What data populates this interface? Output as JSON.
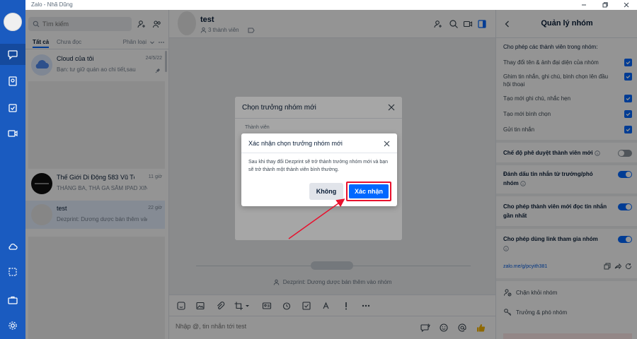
{
  "app": {
    "title": "Zalo - Nhã Dũng"
  },
  "colors": {
    "nav_bg": "#1a5bc0",
    "primary": "#0068ff",
    "highlight": "#e8112d"
  },
  "conversation_list": {
    "search_placeholder": "Tìm kiếm",
    "tabs": [
      "Tất cả",
      "Chưa đọc"
    ],
    "filter_label": "Phân loại",
    "items": [
      {
        "name": "Cloud của tôi",
        "message": "Bạn: tư giữ quán ao chi tiết,sau",
        "time": "24/5/22"
      },
      {
        "name": "Thế Giới Di Động 583 Vũ Tô...",
        "message": "THÁNG BA, THÁ GA SẮM IPAD XIN...",
        "time": "11 giờ"
      },
      {
        "name": "test",
        "message": "Dezprint: Dương dược bán thêm vào...",
        "time": "22 giờ"
      }
    ]
  },
  "chat": {
    "name": "test",
    "members": "3 thành viên",
    "system_message": "Dezprint: Dương dược bán thêm vào nhóm",
    "composer_placeholder": "Nhập @, tin nhắn tới test"
  },
  "right_panel": {
    "title": "Quản lý nhóm",
    "permissions_title": "Cho phép các thành viên trong nhóm:",
    "permissions": [
      "Thay đổi tên & ảnh đại diện của nhóm",
      "Ghim tin nhắn, ghi chú, bình chọn lên đầu hội thoại",
      "Tạo mới ghi chú, nhắc hẹn",
      "Tạo mới bình chọn",
      "Gửi tin nhắn"
    ],
    "toggles": [
      {
        "label": "Chế độ phê duyệt thành viên mới",
        "on": false
      },
      {
        "label": "Đánh dấu tin nhắn từ trưởng/phó nhóm",
        "on": true
      },
      {
        "label": "Cho phép thành viên mới đọc tin nhắn gần nhất",
        "on": true
      },
      {
        "label": "Cho phép dùng link tham gia nhóm",
        "on": true
      }
    ],
    "group_link": "zalo.me/g/pcyith381",
    "actions": [
      "Chặn khỏi nhóm",
      "Trưởng & phó nhóm"
    ]
  },
  "dialog_select_leader": {
    "title": "Chọn trưởng nhóm mới",
    "label": "Thành viên"
  },
  "dialog_confirm": {
    "title": "Xác nhận chọn trưởng nhóm mới",
    "body": "Sau khi thay đổi Dezprint sẽ trở thành trưởng nhóm mới và bạn sẽ trở thành một thành viên bình thường.",
    "cancel_label": "Không",
    "confirm_label": "Xác nhận"
  }
}
